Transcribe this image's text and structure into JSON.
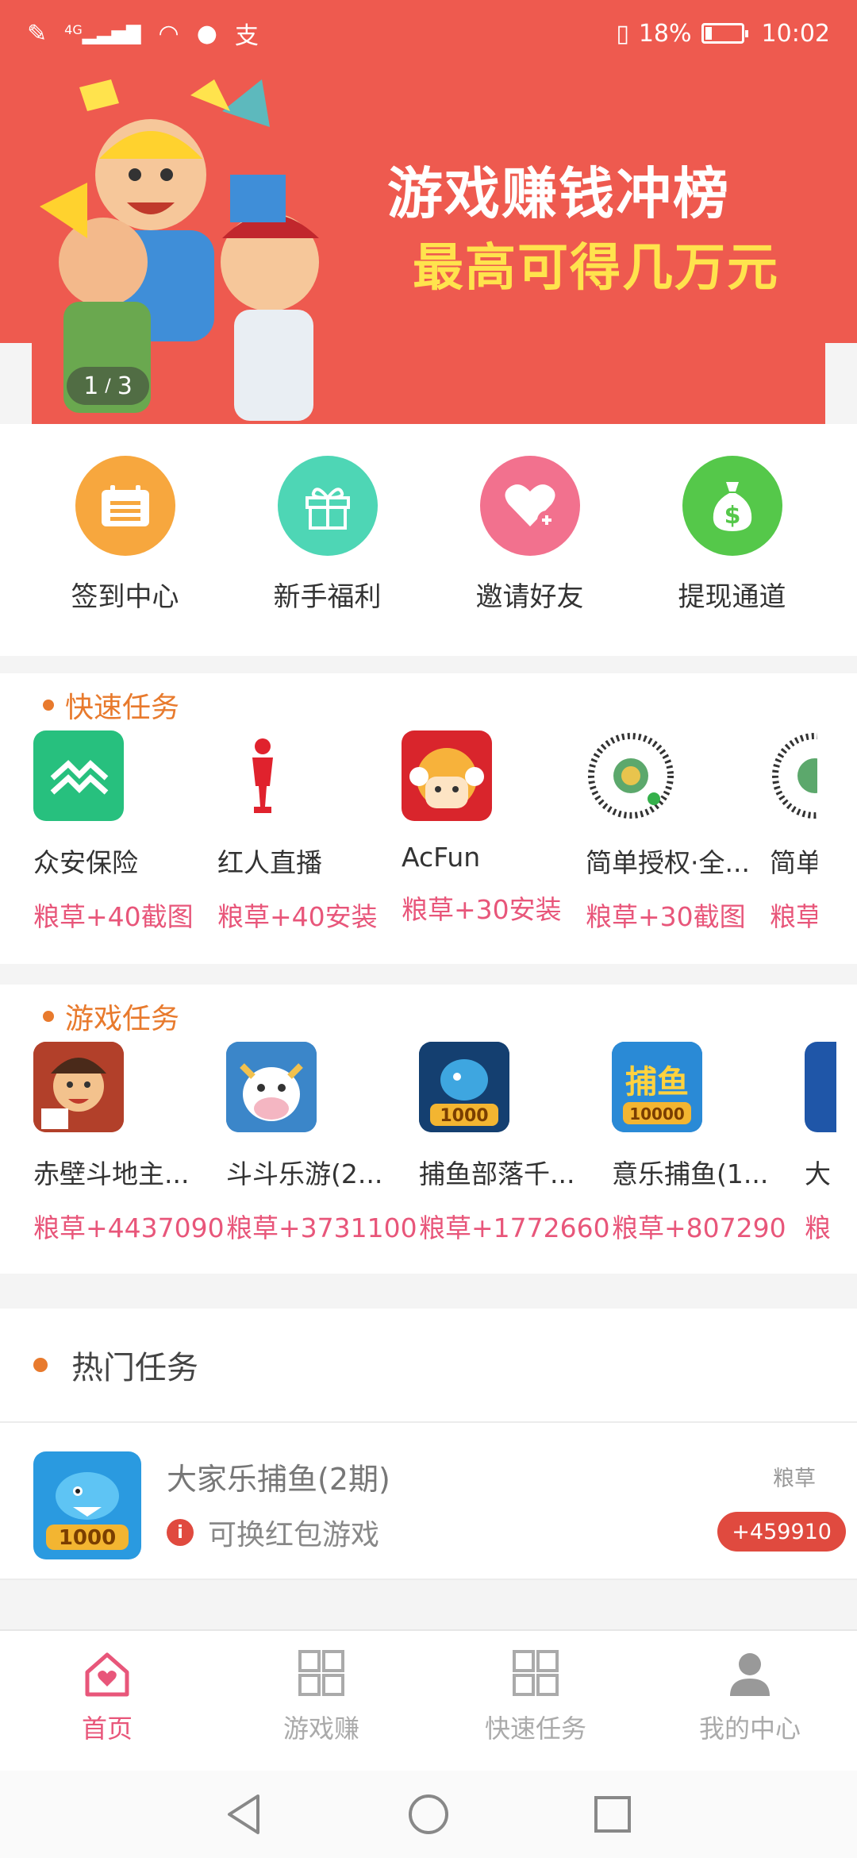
{
  "status_bar": {
    "network": "4G",
    "battery_percent": "18%",
    "battery_level": 0.18,
    "time": "10:02",
    "icons": [
      "pencil-icon",
      "signal-icon",
      "wifi-icon",
      "qq-icon",
      "alipay-icon",
      "vibrate-icon",
      "battery-icon"
    ]
  },
  "banner": {
    "title": "游戏赚钱冲榜",
    "subtitle": "最高可得几万元",
    "pager_current": "1",
    "pager_separator": "/",
    "pager_total": "3"
  },
  "shortcuts": [
    {
      "label": "签到中心",
      "icon": "calendar-icon",
      "color": "#f7a73e"
    },
    {
      "label": "新手福利",
      "icon": "gift-icon",
      "color": "#4ed6b5"
    },
    {
      "label": "邀请好友",
      "icon": "heart-plus-icon",
      "color": "#f2718e"
    },
    {
      "label": "提现通道",
      "icon": "money-bag-icon",
      "color": "#55c84a"
    }
  ],
  "quick_tasks": {
    "title": "快速任务",
    "items": [
      {
        "name": "众安保险",
        "reward": "粮草+40截图"
      },
      {
        "name": "红人直播",
        "reward": "粮草+40安装"
      },
      {
        "name": "AcFun",
        "reward": "粮草+30安装"
      },
      {
        "name": "简单授权·全...",
        "reward": "粮草+30截图"
      },
      {
        "name": "简单",
        "reward": "粮草"
      }
    ]
  },
  "game_tasks": {
    "title": "游戏任务",
    "items": [
      {
        "name": "赤壁斗地主...",
        "reward": "粮草+4437090"
      },
      {
        "name": "斗斗乐游(2...",
        "reward": "粮草+3731100"
      },
      {
        "name": "捕鱼部落千...",
        "reward": "粮草+1772660"
      },
      {
        "name": "意乐捕鱼(1...",
        "reward": "粮草+807290"
      },
      {
        "name": "大",
        "reward": "粮"
      }
    ]
  },
  "hot_tasks": {
    "title": "热门任务",
    "items": [
      {
        "name": "大家乐捕鱼(2期)",
        "desc": "可换红包游戏",
        "unit": "粮草",
        "badge": "+459910"
      }
    ]
  },
  "bottom_nav": [
    {
      "label": "首页",
      "icon": "home-heart-icon",
      "active": true
    },
    {
      "label": "游戏赚",
      "icon": "grid-icon",
      "active": false
    },
    {
      "label": "快速任务",
      "icon": "grid-icon",
      "active": false
    },
    {
      "label": "我的中心",
      "icon": "user-icon",
      "active": false
    }
  ],
  "colors": {
    "accent": "#ee5a4f",
    "section_title": "#e87a2d",
    "reward": "#e8567a",
    "badge": "#e04a3f"
  }
}
